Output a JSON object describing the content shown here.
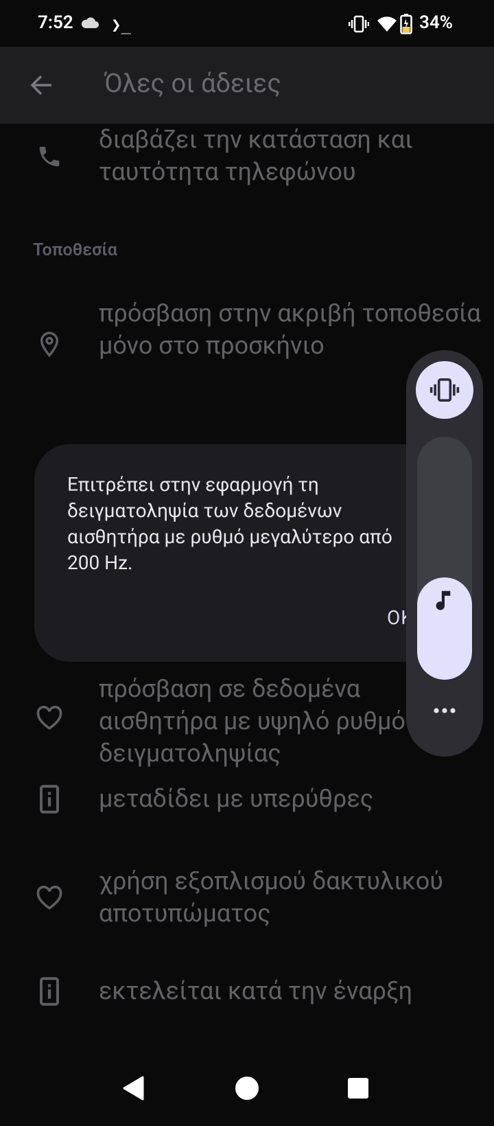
{
  "status_bar": {
    "time": "7:52",
    "terminal_glyph": "❯_",
    "battery_percent": "34%",
    "battery_level": 0.34
  },
  "app_bar": {
    "title": "Όλες οι άδειες"
  },
  "permissions": {
    "phone_state": "διαβάζει την κατάσταση και ταυτότητα τηλεφώνου",
    "location_header": "Τοποθεσία",
    "precise_location": "πρόσβαση στην ακριβή τοποθεσία μόνο στο προσκήνιο",
    "high_rate_sensors": "πρόσβαση σε δεδομένα αισθητήρα με υψηλό ρυθμό δειγματοληψίας",
    "infrared": "μεταδίδει με υπερύθρες",
    "fingerprint": "χρήση εξοπλισμού δακτυλικού αποτυπώματος",
    "run_at_startup": "εκτελείται κατά την έναρξη"
  },
  "dialog": {
    "message": "Επιτρέπει στην εφαρμογή τη δειγματοληψία των δεδομένων αισθητήρα με ρυθμό μεγαλύτερο από 200 Hz.",
    "ok_label": "ΟΚ"
  },
  "volume_panel": {
    "ringer_mode": "vibrate",
    "media_level": 0.42
  },
  "colors": {
    "background": "#0a0a0b",
    "app_bar": "#1e1e20",
    "dialog": "#1d1d21",
    "accent": "#e2e0fb"
  }
}
